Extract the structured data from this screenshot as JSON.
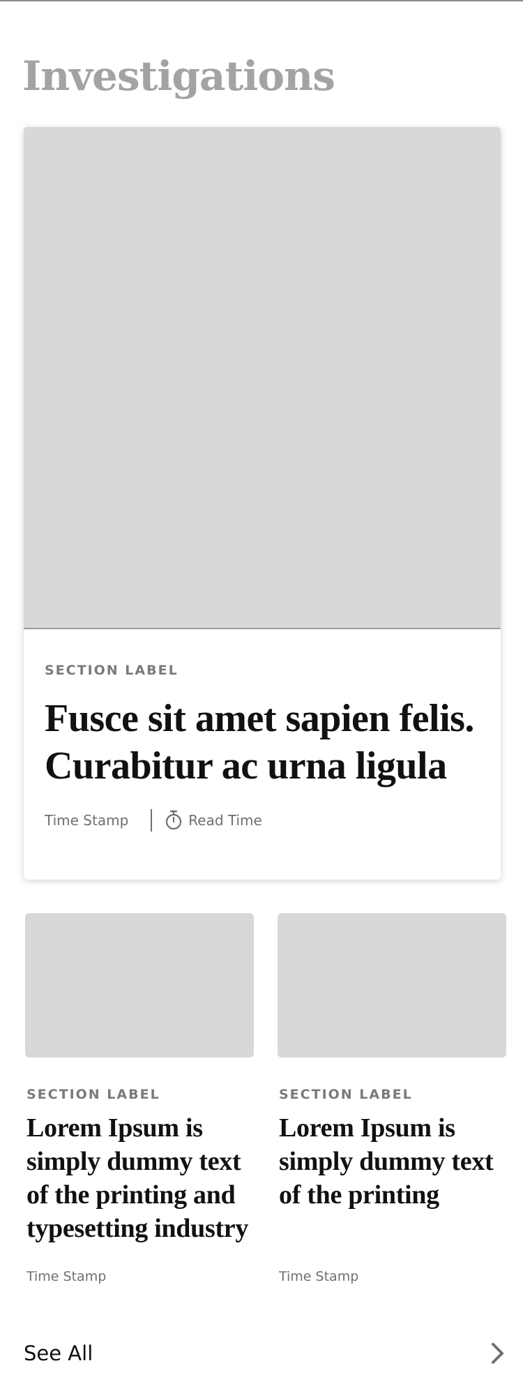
{
  "section": {
    "title": "Investigations"
  },
  "hero": {
    "label": "SECTION LABEL",
    "headline": "Fusce sit amet sapien felis. Curabitur ac urna ligula",
    "timestamp": "Time Stamp",
    "read_time": "Read Time",
    "icon": "timer-icon"
  },
  "cards": [
    {
      "label": "SECTION LABEL",
      "headline": "Lorem Ipsum is simply dummy text of the printing and typesetting industry",
      "timestamp": "Time Stamp"
    },
    {
      "label": "SECTION LABEL",
      "headline": "Lorem Ipsum is simply dummy text of the printing",
      "timestamp": "Time Stamp"
    }
  ],
  "footer": {
    "see_all": "See All",
    "icon": "chevron-right-icon"
  },
  "colors": {
    "placeholder": "#d8d8d8",
    "title": "#a3a3a3",
    "label": "#7a7a7a",
    "headline": "#111111",
    "meta": "#6f6f6f"
  }
}
